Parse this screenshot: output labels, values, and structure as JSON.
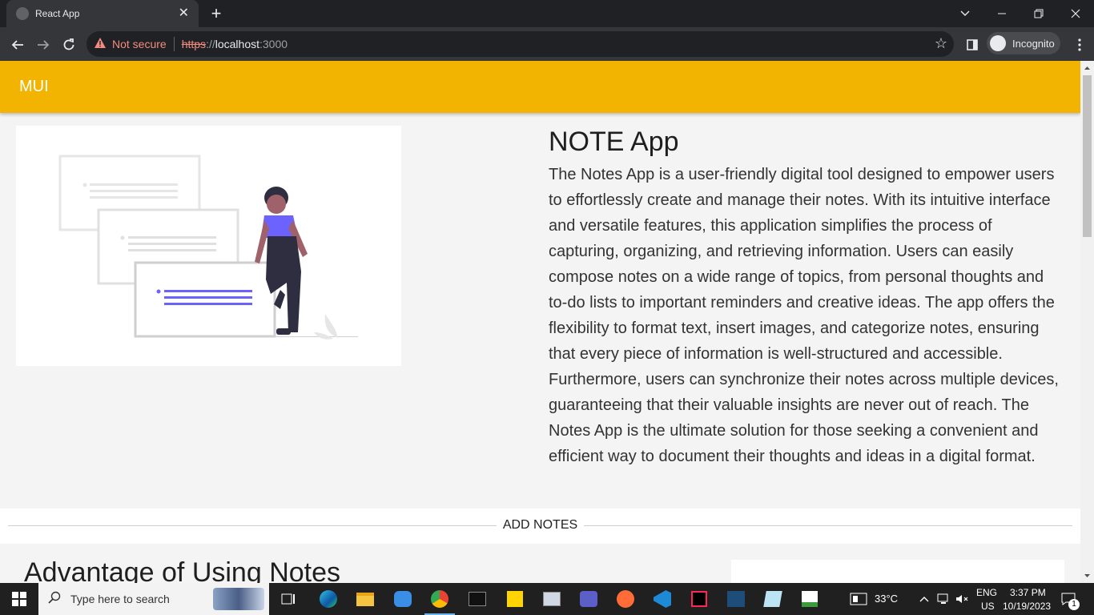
{
  "browser": {
    "tab_title": "React App",
    "close_glyph": "✕",
    "new_tab_glyph": "+",
    "security_label": "Not secure",
    "url_scheme": "https",
    "url_sep": "://",
    "url_host": "localhost",
    "url_port": ":3000",
    "profile_label": "Incognito"
  },
  "app": {
    "brand": "MUI",
    "heading": "NOTE App",
    "description": "The Notes App is a user-friendly digital tool designed to empower users to effortlessly create and manage their notes. With its intuitive interface and versatile features, this application simplifies the process of capturing, organizing, and retrieving information. Users can easily compose notes on a wide range of topics, from personal thoughts and to-do lists to important reminders and creative ideas. The app offers the flexibility to format text, insert images, and categorize notes, ensuring that every piece of information is well-structured and accessible. Furthermore, users can synchronize their notes across multiple devices, guaranteeing that their valuable insights are never out of reach. The Notes App is the ultimate solution for those seeking a convenient and efficient way to document their thoughts and ideas in a digital format.",
    "divider_label": "ADD NOTES",
    "section_title": "Advantage of Using Notes",
    "accent_color": "#f2b400"
  },
  "taskbar": {
    "search_placeholder": "Type here to search",
    "weather": "33°C",
    "lang_top": "ENG",
    "lang_bottom": "US",
    "time": "3:37 PM",
    "date": "10/19/2023",
    "notification_count": "1"
  }
}
